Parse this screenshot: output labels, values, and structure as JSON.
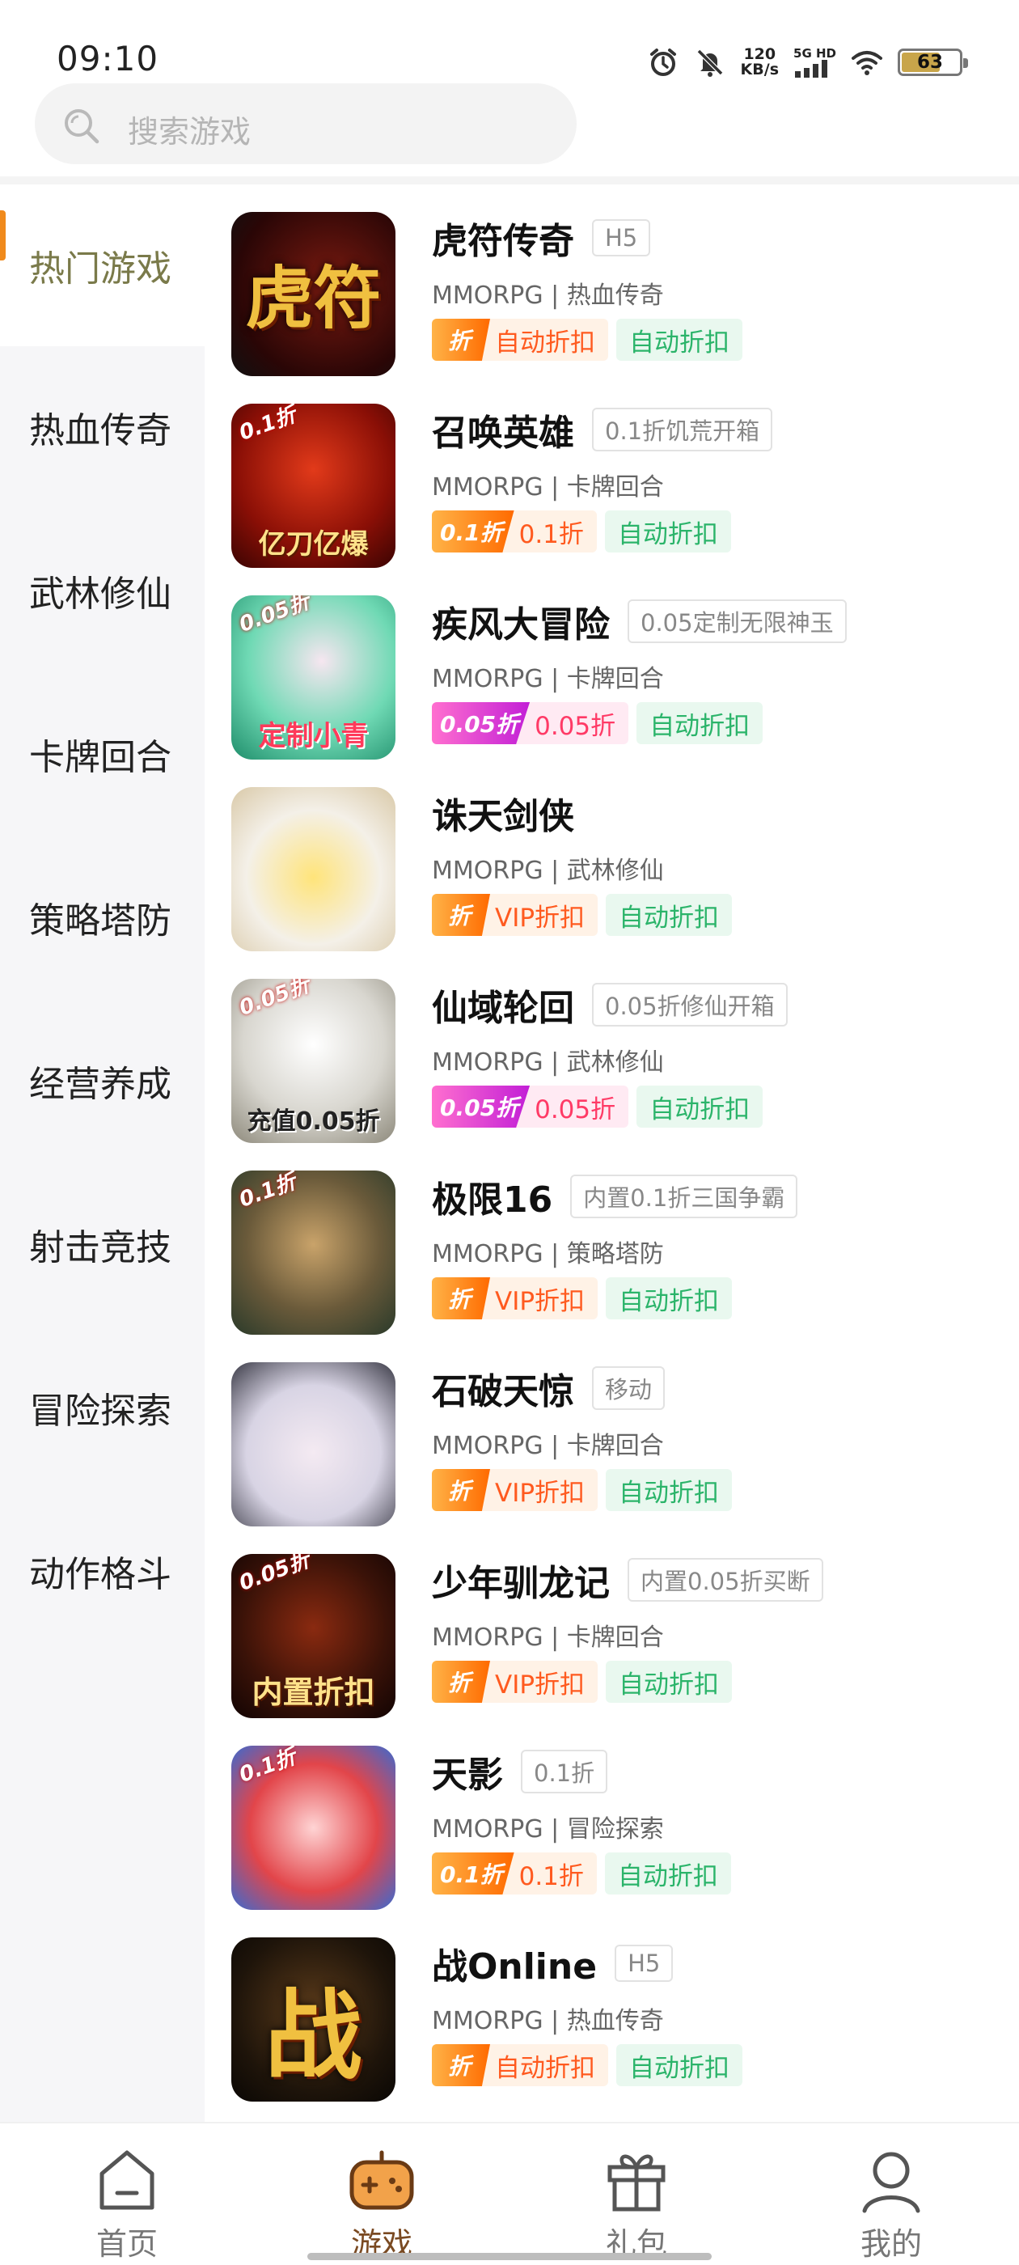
{
  "status_bar": {
    "time": "09:10",
    "net_speed_value": "120",
    "net_speed_unit": "KB/s",
    "signal_label": "5G HD",
    "battery_level": "63"
  },
  "search": {
    "placeholder": "搜索游戏"
  },
  "sidebar": {
    "items": [
      {
        "label": "热门游戏",
        "active": true
      },
      {
        "label": "热血传奇"
      },
      {
        "label": "武林修仙"
      },
      {
        "label": "卡牌回合"
      },
      {
        "label": "策略塔防"
      },
      {
        "label": "经营养成"
      },
      {
        "label": "射击竞技"
      },
      {
        "label": "冒险探索"
      },
      {
        "label": "动作格斗"
      }
    ]
  },
  "games": [
    {
      "title": "虎符传奇",
      "tag": "H5",
      "genre": "MMORPG | 热血传奇",
      "discount_icon": "折",
      "discount_text": "自动折扣",
      "auto_label": "自动折扣",
      "icon_char": "虎符",
      "icon_badge": "",
      "icon_caption": ""
    },
    {
      "title": "召唤英雄",
      "tag": "0.1折饥荒开箱",
      "genre": "MMORPG | 卡牌回合",
      "discount_icon": "0.1折",
      "discount_text": "0.1折",
      "auto_label": "自动折扣",
      "icon_char": "",
      "icon_badge": "0.1折",
      "icon_caption": "亿刀亿爆"
    },
    {
      "title": "疾风大冒险",
      "tag": "0.05定制无限神玉",
      "genre": "MMORPG | 卡牌回合",
      "discount_icon": "0.05折",
      "discount_text": "0.05折",
      "auto_label": "自动折扣",
      "icon_char": "",
      "icon_badge": "0.05折",
      "icon_caption": "定制小青"
    },
    {
      "title": "诛天剑侠",
      "tag": "",
      "genre": "MMORPG | 武林修仙",
      "discount_icon": "折",
      "discount_text": "VIP折扣",
      "auto_label": "自动折扣",
      "icon_char": "",
      "icon_badge": "",
      "icon_caption": ""
    },
    {
      "title": "仙域轮回",
      "tag": "0.05折修仙开箱",
      "genre": "MMORPG | 武林修仙",
      "discount_icon": "0.05折",
      "discount_text": "0.05折",
      "auto_label": "自动折扣",
      "icon_char": "",
      "icon_badge": "0.05折",
      "icon_caption": "充值0.05折"
    },
    {
      "title": "极限16",
      "tag": "内置0.1折三国争霸",
      "genre": "MMORPG | 策略塔防",
      "discount_icon": "折",
      "discount_text": "VIP折扣",
      "auto_label": "自动折扣",
      "icon_char": "",
      "icon_badge": "0.1折",
      "icon_caption": ""
    },
    {
      "title": "石破天惊",
      "tag": "移动",
      "genre": "MMORPG | 卡牌回合",
      "discount_icon": "折",
      "discount_text": "VIP折扣",
      "auto_label": "自动折扣",
      "icon_char": "",
      "icon_badge": "",
      "icon_caption": ""
    },
    {
      "title": "少年驯龙记",
      "tag": "内置0.05折买断",
      "genre": "MMORPG | 卡牌回合",
      "discount_icon": "折",
      "discount_text": "VIP折扣",
      "auto_label": "自动折扣",
      "icon_char": "",
      "icon_badge": "0.05折",
      "icon_caption": "内置折扣"
    },
    {
      "title": "天影",
      "tag": "0.1折",
      "genre": "MMORPG | 冒险探索",
      "discount_icon": "0.1折",
      "discount_text": "0.1折",
      "auto_label": "自动折扣",
      "icon_char": "",
      "icon_badge": "0.1折",
      "icon_caption": ""
    },
    {
      "title": "战Online",
      "tag": "H5",
      "genre": "MMORPG | 热血传奇",
      "discount_icon": "折",
      "discount_text": "自动折扣",
      "auto_label": "自动折扣",
      "icon_char": "战",
      "icon_badge": "",
      "icon_caption": ""
    }
  ],
  "bottom_nav": {
    "items": [
      {
        "label": "首页",
        "icon": "home-icon"
      },
      {
        "label": "游戏",
        "icon": "gamepad-icon",
        "active": true
      },
      {
        "label": "礼包",
        "icon": "gift-icon"
      },
      {
        "label": "我的",
        "icon": "profile-icon"
      }
    ]
  },
  "colors": {
    "accent": "#f08a1c",
    "active_sidebar_text": "#7a7a4a",
    "discount_orange": "#ff5a1f",
    "auto_green": "#2bb46a",
    "nav_active": "#7a4a22"
  }
}
